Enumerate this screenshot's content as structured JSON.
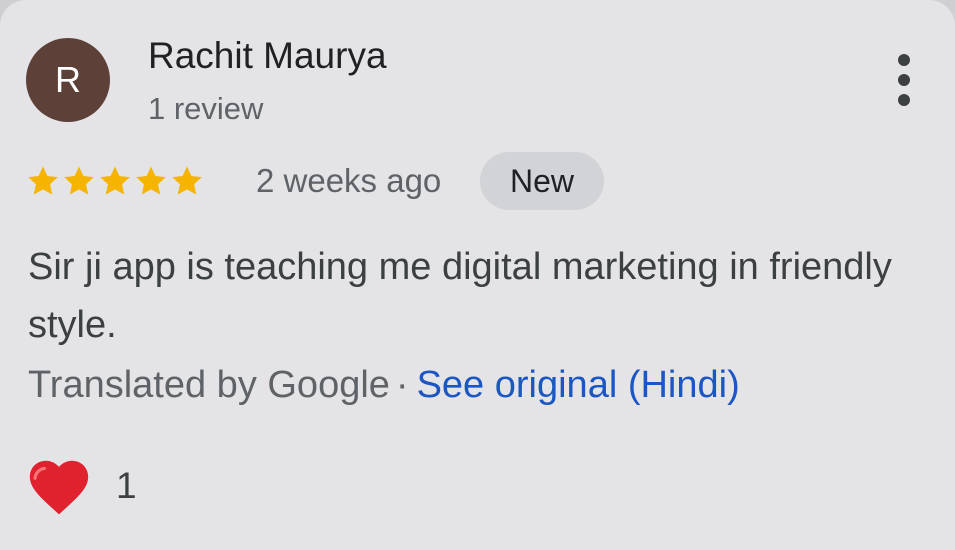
{
  "review": {
    "reviewer_initial": "R",
    "reviewer_name": "Rachit Maurya",
    "review_count": "1 review",
    "rating": 5,
    "rating_max": 5,
    "time_ago": "2 weeks ago",
    "badge": "New",
    "text": "Sir ji app is teaching me digital marketing in friendly style.",
    "translated_label": "Translated by Google",
    "separator": "·",
    "see_original_label": "See original (Hindi)",
    "reaction_icon": "heart-icon",
    "reaction_count": "1"
  },
  "colors": {
    "avatar_bg": "#5d4037",
    "star": "#f4b400",
    "link": "#1a56c4",
    "heart": "#e0212e",
    "card_bg": "#e4e4e6",
    "badge_bg": "#d2d3d6"
  },
  "icons": {
    "menu": "more-vert-icon",
    "star": "star-icon"
  }
}
